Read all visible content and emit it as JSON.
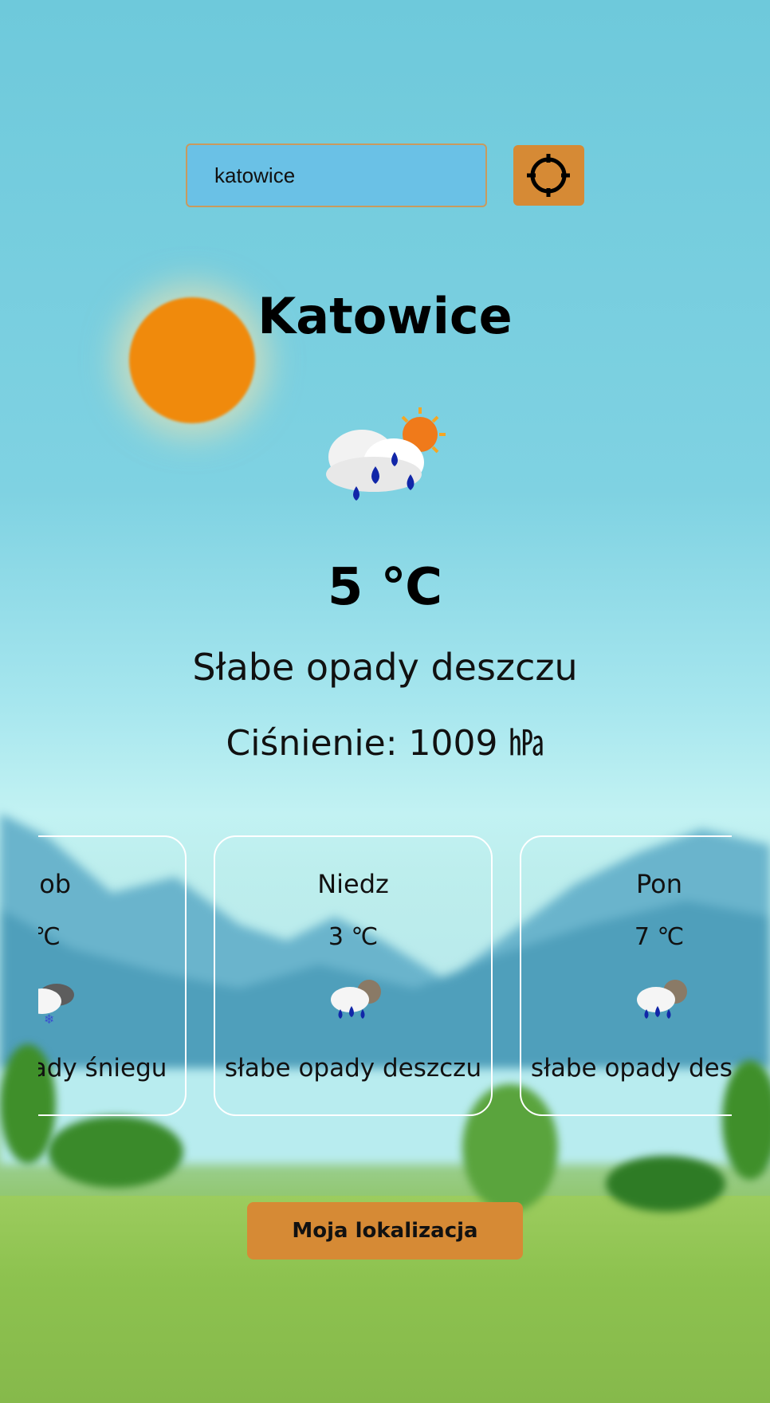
{
  "search": {
    "value": "katowice"
  },
  "current": {
    "city": "Katowice",
    "icon": "rain-cloud-with-sun-icon",
    "temperature": "5 ℃",
    "description": "Słabe opady deszczu",
    "pressure": "Ciśnienie: 1009 ㍱"
  },
  "forecast": [
    {
      "day": "Sob",
      "temp": "℃",
      "icon": "snow-cloud-icon",
      "description": "słabe opady śniegu"
    },
    {
      "day": "Niedz",
      "temp": "3 ℃",
      "icon": "rain-cloud-icon",
      "description": "słabe opady deszczu"
    },
    {
      "day": "Pon",
      "temp": "7 ℃",
      "icon": "rain-cloud-icon",
      "description": "słabe opady deszczu"
    }
  ],
  "buttons": {
    "locate_icon": "crosshair-icon",
    "my_location": "Moja lokalizacja"
  },
  "colors": {
    "accent": "#d68a35",
    "input_bg": "#6ac1e6",
    "card_border": "#ffffff"
  }
}
